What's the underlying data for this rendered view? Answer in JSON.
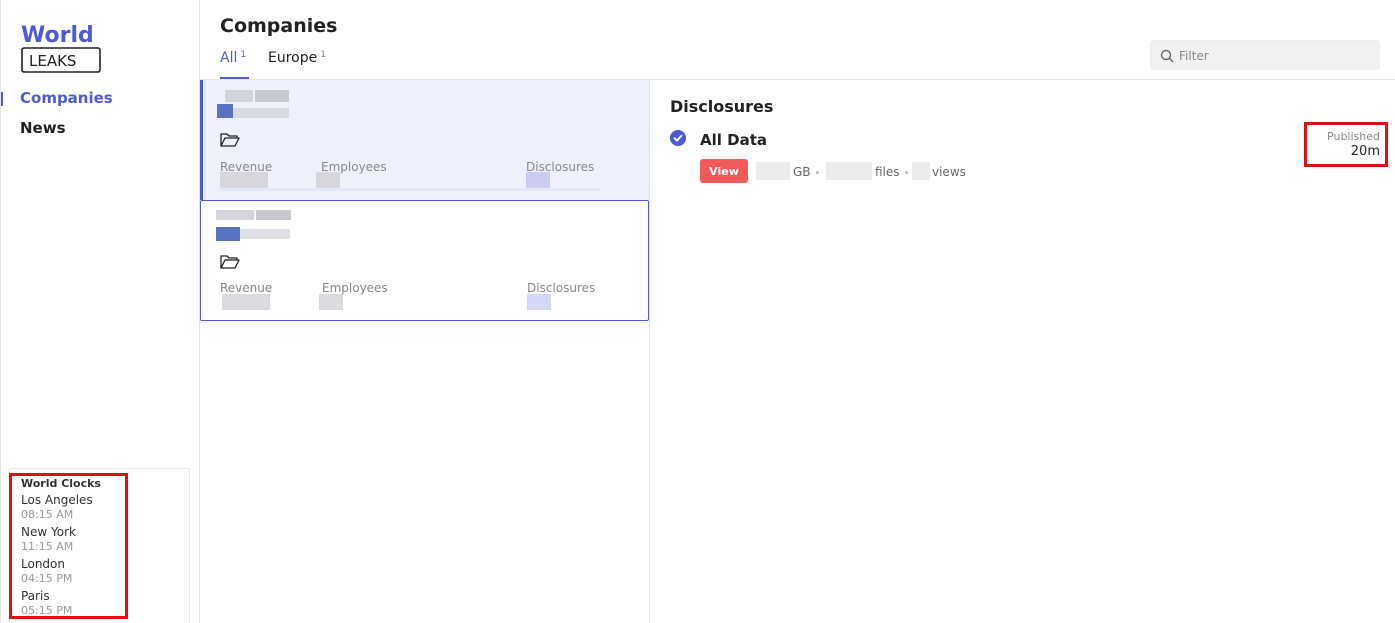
{
  "sidebar": {
    "logo_text_top": "World",
    "logo_text_bottom": "LEAKS",
    "nav": [
      {
        "label": "Companies",
        "active": true
      },
      {
        "label": "News",
        "active": false
      }
    ],
    "world_clocks": {
      "title": "World Clocks",
      "clocks": [
        {
          "city": "Los Angeles",
          "time": "08:15 AM"
        },
        {
          "city": "New York",
          "time": "11:15 AM"
        },
        {
          "city": "London",
          "time": "04:15 PM"
        },
        {
          "city": "Paris",
          "time": "05:15 PM"
        }
      ]
    }
  },
  "header": {
    "title": "Companies",
    "tabs": [
      {
        "label": "All",
        "count": "1",
        "active": true
      },
      {
        "label": "Europe",
        "count": "1",
        "active": false
      }
    ],
    "filter": {
      "placeholder": "Filter",
      "value": ""
    }
  },
  "companies": [
    {
      "revenue_label": "Revenue",
      "employees_label": "Employees",
      "disclosures_label": "Disclosures",
      "selected": true
    },
    {
      "revenue_label": "Revenue",
      "employees_label": "Employees",
      "disclosures_label": "Disclosures",
      "selected": false
    }
  ],
  "disclosures": {
    "title": "Disclosures",
    "entries": [
      {
        "name": "All Data",
        "view_label": "View",
        "size_unit": "GB",
        "files_label": "files",
        "views_label": "views",
        "published_label": "Published",
        "published_value": "20m"
      }
    ]
  },
  "colors": {
    "accent": "#4f5bd5",
    "view_button": "#f05a5a",
    "highlight_box": "#e01010"
  }
}
